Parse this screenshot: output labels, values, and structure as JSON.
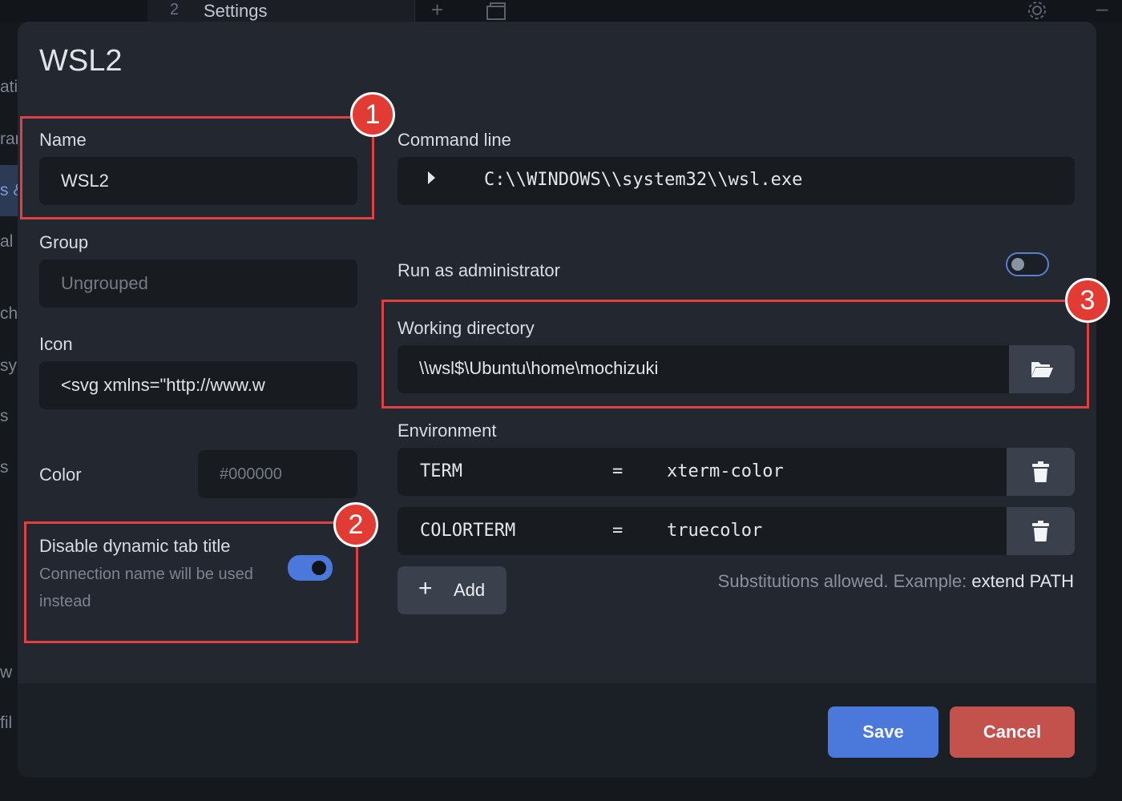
{
  "app": {
    "tab_number": "2",
    "tab_title": "Settings"
  },
  "sidebar_fragments": [
    "atio",
    "rar",
    "s &",
    "al",
    "ch",
    "sy",
    "s",
    "s",
    "w",
    "fil"
  ],
  "modal": {
    "title": "WSL2",
    "name": {
      "label": "Name",
      "value": "WSL2"
    },
    "group": {
      "label": "Group",
      "placeholder": "Ungrouped"
    },
    "icon": {
      "label": "Icon",
      "value": "<svg xmlns=\"http://www.w"
    },
    "color": {
      "label": "Color",
      "placeholder": "#000000"
    },
    "dynamic_title": {
      "label": "Disable dynamic tab title",
      "sublabel": "Connection name will be used instead",
      "enabled": true
    },
    "command_line": {
      "label": "Command line",
      "value": "C:\\\\WINDOWS\\\\system32\\\\wsl.exe"
    },
    "run_as_admin": {
      "label": "Run as administrator",
      "enabled": false
    },
    "working_directory": {
      "label": "Working directory",
      "value": "\\\\wsl$\\Ubuntu\\home\\mochizuki"
    },
    "environment": {
      "label": "Environment",
      "separator": "=",
      "rows": [
        {
          "name": "TERM",
          "value": "xterm-color"
        },
        {
          "name": "COLORTERM",
          "value": "truecolor"
        }
      ],
      "add_label": "Add",
      "hint_prefix": "Substitutions allowed. Example:",
      "hint_example": "extend PATH"
    },
    "save_label": "Save",
    "cancel_label": "Cancel"
  },
  "annotations": [
    "1",
    "2",
    "3"
  ],
  "colors": {
    "accent": "#4a78db",
    "danger": "#c4524c",
    "highlight": "#e0403f"
  }
}
